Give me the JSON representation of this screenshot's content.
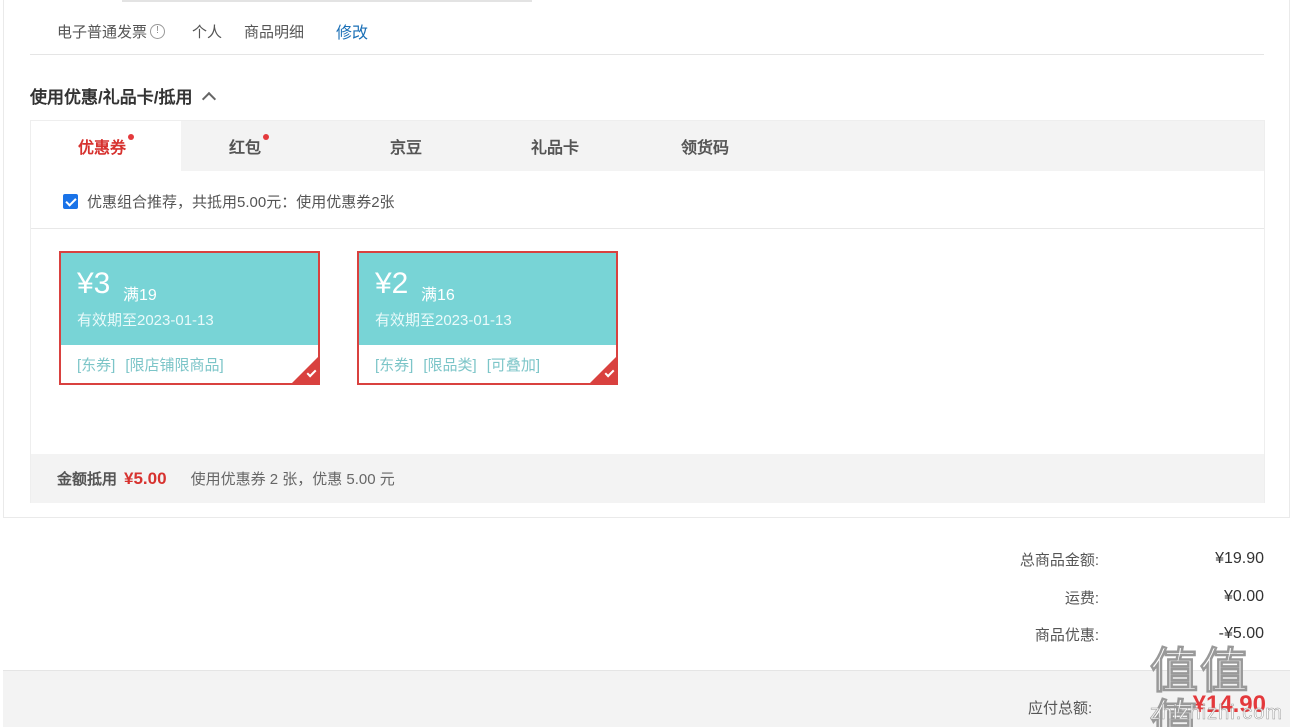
{
  "invoice": {
    "type": "电子普通发票",
    "info_icon": "!",
    "title": "个人",
    "content": "商品明细",
    "edit_label": "修改"
  },
  "discount_section": {
    "title": "使用优惠/礼品卡/抵用",
    "tabs": [
      {
        "label": "优惠券",
        "active": true,
        "dot": true
      },
      {
        "label": "红包",
        "active": false,
        "dot": true
      },
      {
        "label": "京豆",
        "active": false,
        "dot": false
      },
      {
        "label": "礼品卡",
        "active": false,
        "dot": false
      },
      {
        "label": "领货码",
        "active": false,
        "dot": false
      }
    ],
    "recommend_text": "优惠组合推荐，共抵用5.00元：使用优惠券2张",
    "recommend_checked": true,
    "coupons": [
      {
        "amount": "¥3",
        "condition": "满19",
        "valid": "有效期至2023-01-13",
        "tags": [
          "[东券]",
          "[限店铺限商品]"
        ],
        "selected": true
      },
      {
        "amount": "¥2",
        "condition": "满16",
        "valid": "有效期至2023-01-13",
        "tags": [
          "[东券]",
          "[限品类]",
          "[可叠加]"
        ],
        "selected": true
      }
    ],
    "summary": {
      "label": "金额抵用",
      "amount": "¥5.00",
      "desc": "使用优惠券 2 张，优惠 5.00 元"
    }
  },
  "totals": {
    "goods_label": "总商品金额:",
    "goods_value": "¥19.90",
    "shipping_label": "运费:",
    "shipping_value": "¥0.00",
    "discount_label": "商品优惠:",
    "discount_value": "-¥5.00"
  },
  "payment": {
    "label": "应付总额:",
    "value": "¥14.90"
  },
  "watermark": {
    "glyphs": "值值值",
    "url": "zhizhizhi.com"
  },
  "colors": {
    "accent_red": "#e4393c",
    "coupon_teal": "#78d4d6",
    "link_blue": "#1a6fb6"
  }
}
